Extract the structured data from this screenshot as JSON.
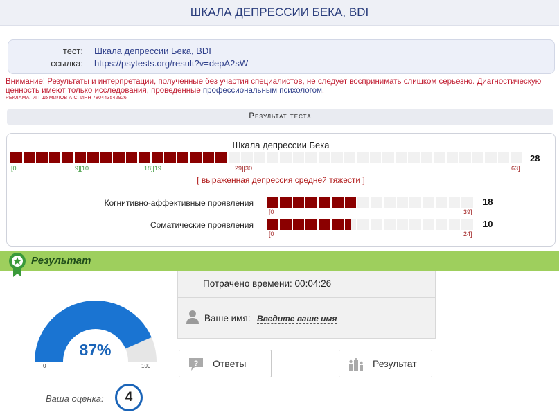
{
  "header": {
    "title": "ШКАЛА ДЕПРЕССИИ БЕКА, BDI"
  },
  "info": {
    "test_key": "тест:",
    "test_value": "Шкала депрессии Бека, BDI",
    "link_key": "ссылка:",
    "link_value": "https://psytests.org/result?v=depA2sW"
  },
  "warning": {
    "text": "Внимание! Результаты и интерпретации, полученные без участия специалистов, не следует воспринимать слишком серьезно. Диагностическую ценность имеют только исследования, проведенные ",
    "highlight": "профессиональным психологом",
    "end": ".",
    "ad": "РЕКЛАМА. ИП ШУМИЛОВ А.С. ИНН 780443542926"
  },
  "result_header": "Результат теста",
  "scale": {
    "title": "Шкала депрессии Бека",
    "score": 28,
    "max": 63,
    "segments": 40,
    "filled_segments": 17,
    "ticks": [
      {
        "label": "[0",
        "color": "green"
      },
      {
        "label": "9][10",
        "color": "green"
      },
      {
        "label": "18][19",
        "color": "green"
      },
      {
        "label": "29][30",
        "color": "red"
      },
      {
        "label": "63]",
        "color": "red"
      }
    ],
    "severity": "[ выраженная депрессия средней тяжести ]"
  },
  "subscales": [
    {
      "label": "Когнитивно-аффективные проявления",
      "score": 18,
      "min_label": "[0",
      "max_label": "39]",
      "segments": 16,
      "filled_segments": 7
    },
    {
      "label": "Соматические проявления",
      "score": 10,
      "min_label": "[0",
      "max_label": "24]",
      "segments": 16,
      "filled_segments": 6.5
    }
  ],
  "result_band": {
    "title": "Результат",
    "icon": "award-ribbon-icon"
  },
  "timing": {
    "time_label": "Потрачено времени: 00:04:26",
    "name_label": "Ваше имя:",
    "name_link": "Введите ваше имя"
  },
  "gauge": {
    "percent": 87,
    "percent_label": "87%",
    "min_label": "0",
    "max_label": "100"
  },
  "grade": {
    "label": "Ваша оценка:",
    "value": "4"
  },
  "buttons": {
    "answers": "Ответы",
    "result": "Результат"
  },
  "colors": {
    "bar_fill": "#8b0000",
    "bar_empty": "#f1f1f1",
    "accent_blue": "#1a64b8",
    "green_band": "#9ecf5d",
    "warning_red": "#c11f33"
  }
}
